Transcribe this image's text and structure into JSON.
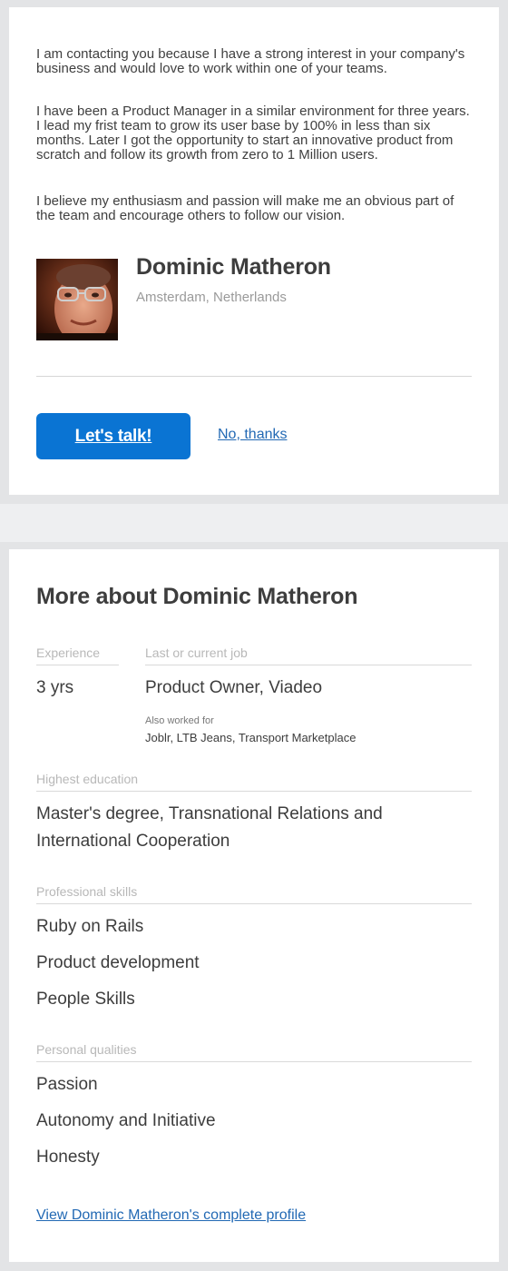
{
  "message": {
    "paragraphs": [
      "I am contacting you because I have a strong interest in your company's business and would love to work within one of your teams.",
      "I have been a Product Manager in a similar environment for three years. I lead my frist team to grow its user base by 100% in less than six months. Later I got the opportunity to start an innovative product from scratch and follow its growth from zero to 1 Million users.",
      "I believe my enthusiasm and passion will make me an obvious part of the team and encourage others to follow our vision."
    ]
  },
  "candidate": {
    "name": "Dominic Matheron",
    "location": "Amsterdam, Netherlands"
  },
  "actions": {
    "primary_label": "Let's talk!",
    "secondary_label": "No, thanks"
  },
  "more": {
    "title": "More about Dominic Matheron",
    "experience_label": "Experience",
    "experience_value": "3 yrs",
    "job_label": "Last or current job",
    "job_value": "Product Owner, Viadeo",
    "also_worked_label": "Also worked for",
    "also_worked_value": "Joblr, LTB Jeans, Transport Marketplace",
    "education_label": "Highest education",
    "education_line1": "Master's degree, Transnational Relations and",
    "education_line2": "International Cooperation",
    "skills_label": "Professional skills",
    "skills": [
      "Ruby on Rails",
      "Product development",
      "People Skills"
    ],
    "qualities_label": "Personal qualities",
    "qualities": [
      "Passion",
      "Autonomy and Initiative",
      "Honesty"
    ],
    "profile_link": "View Dominic Matheron's complete profile"
  },
  "colors": {
    "button": "#0a74d3",
    "link": "#2269b4",
    "frame": "#e3e4e6",
    "background": "#eeeff1"
  }
}
